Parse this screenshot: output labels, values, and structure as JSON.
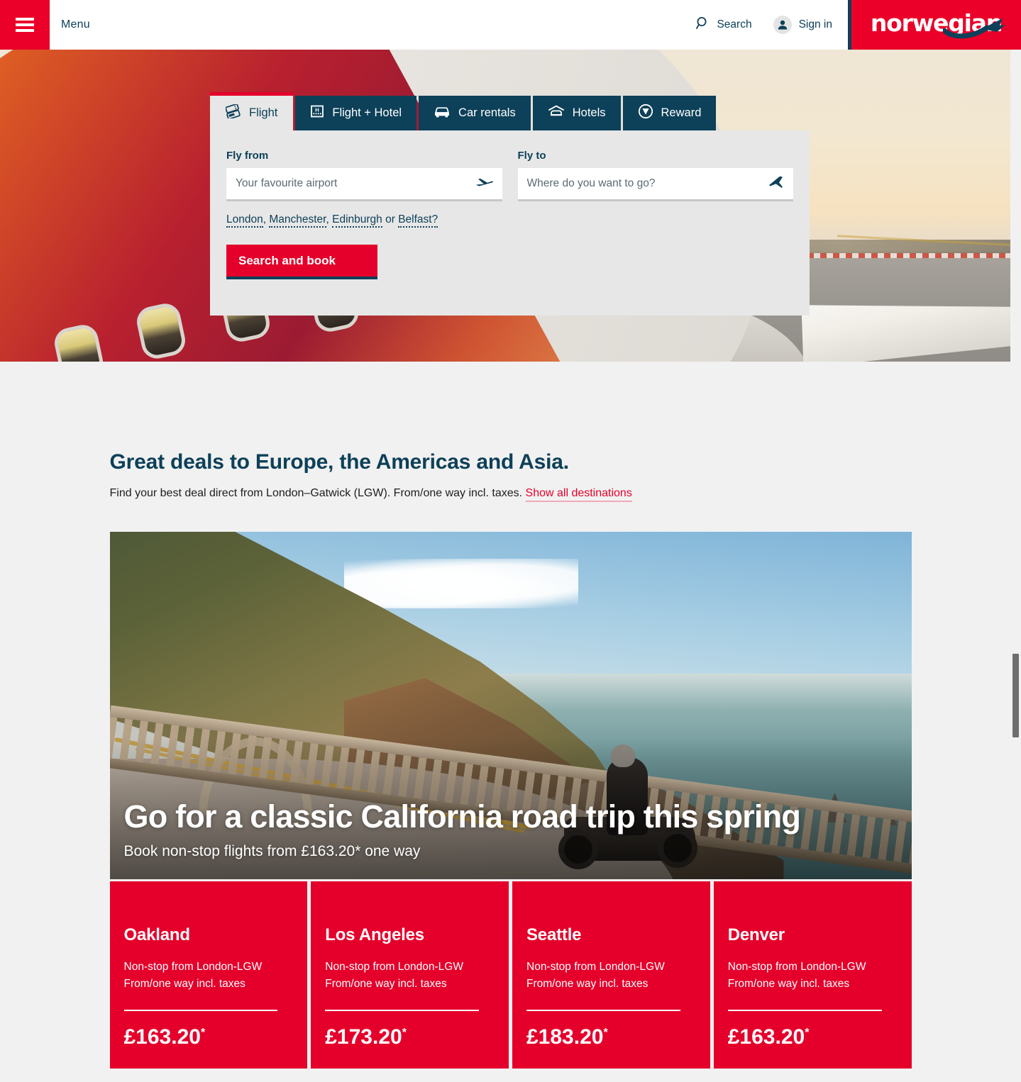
{
  "header": {
    "menu_label": "Menu",
    "search_label": "Search",
    "signin_label": "Sign in",
    "logo_text": "norwegian",
    "brand_red": "#ea0029",
    "brand_navy": "#0d4059"
  },
  "booking": {
    "tabs": [
      {
        "label": "Flight",
        "icon": "boarding-pass-icon",
        "active": true
      },
      {
        "label": "Flight + Hotel",
        "icon": "hotel-building-icon",
        "active": false
      },
      {
        "label": "Car rentals",
        "icon": "car-icon",
        "active": false
      },
      {
        "label": "Hotels",
        "icon": "bed-icon",
        "active": false
      },
      {
        "label": "Reward",
        "icon": "reward-shield-icon",
        "active": false
      }
    ],
    "fly_from_label": "Fly from",
    "fly_from_placeholder": "Your favourite airport",
    "fly_from_value": "",
    "fly_to_label": "Fly to",
    "fly_to_placeholder": "Where do you want to go?",
    "fly_to_value": "",
    "suggestions": [
      "London",
      "Manchester",
      "Edinburgh",
      "Belfast?"
    ],
    "suggestion_separator_1": ", ",
    "suggestion_separator_2": ", ",
    "suggestion_separator_3": " or ",
    "search_button": "Search and book"
  },
  "deals": {
    "heading": "Great deals to Europe, the Americas and Asia.",
    "subtext": "Find your best deal direct from London–Gatwick (LGW). From/one way incl. taxes. ",
    "show_all_link": "Show all destinations",
    "promo_title": "Go for a classic California road trip this spring",
    "promo_subtitle": "Book non-stop flights from £163.20* one way",
    "cards": [
      {
        "city": "Oakland",
        "line1": "Non-stop from London-LGW",
        "line2": "From/one way incl. taxes",
        "price": "£163.20",
        "asterisk": "*"
      },
      {
        "city": "Los Angeles",
        "line1": "Non-stop from London-LGW",
        "line2": "From/one way incl. taxes",
        "price": "£173.20",
        "asterisk": "*"
      },
      {
        "city": "Seattle",
        "line1": "Non-stop from London-LGW",
        "line2": "From/one way incl. taxes",
        "price": "£183.20",
        "asterisk": "*"
      },
      {
        "city": "Denver",
        "line1": "Non-stop from London-LGW",
        "line2": "From/one way incl. taxes",
        "price": "£163.20",
        "asterisk": "*"
      }
    ]
  }
}
